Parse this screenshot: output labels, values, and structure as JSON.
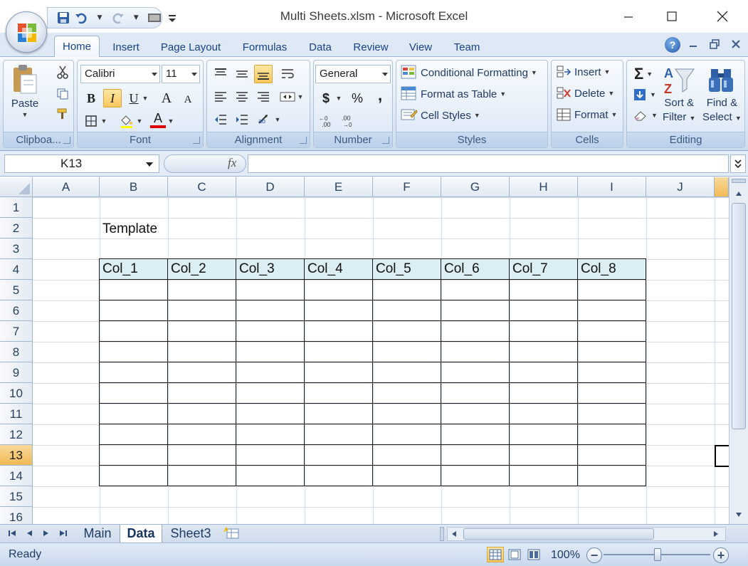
{
  "window": {
    "title": "Multi Sheets.xlsm - Microsoft Excel"
  },
  "ribbon_tabs": [
    {
      "label": "Home",
      "active": true
    },
    {
      "label": "Insert"
    },
    {
      "label": "Page Layout"
    },
    {
      "label": "Formulas"
    },
    {
      "label": "Data"
    },
    {
      "label": "Review"
    },
    {
      "label": "View"
    },
    {
      "label": "Team"
    }
  ],
  "clipboard": {
    "group_label": "Clipboa...",
    "paste_label": "Paste"
  },
  "font": {
    "group_label": "Font",
    "font_name": "Calibri",
    "font_size": "11",
    "bold": "B",
    "italic": "I",
    "underline": "U",
    "grow": "A",
    "shrink": "A",
    "font_color_letter": "A",
    "font_color": "#e00000"
  },
  "alignment": {
    "group_label": "Alignment"
  },
  "number": {
    "group_label": "Number",
    "format": "General",
    "currency": "$",
    "percent": "%",
    "comma": ","
  },
  "styles": {
    "group_label": "Styles",
    "conditional_formatting": "Conditional Formatting",
    "format_as_table": "Format as Table",
    "cell_styles": "Cell Styles"
  },
  "cells": {
    "group_label": "Cells",
    "insert": "Insert",
    "delete": "Delete",
    "format": "Format"
  },
  "editing": {
    "group_label": "Editing",
    "sort_filter_line1": "Sort &",
    "sort_filter_line2": "Filter",
    "find_select_line1": "Find &",
    "find_select_line2": "Select",
    "sigma": "Σ"
  },
  "formula_bar": {
    "name_box": "K13",
    "fx": "fx",
    "formula": ""
  },
  "grid": {
    "columns": [
      "A",
      "B",
      "C",
      "D",
      "E",
      "F",
      "G",
      "H",
      "I",
      "J"
    ],
    "rows": [
      "1",
      "2",
      "3",
      "4",
      "5",
      "6",
      "7",
      "8",
      "9",
      "10",
      "11",
      "12",
      "13",
      "14",
      "15",
      "16"
    ],
    "active_row": "13",
    "cells": {
      "B2": "Template"
    },
    "table_headers": [
      "Col_1",
      "Col_2",
      "Col_3",
      "Col_4",
      "Col_5",
      "Col_6",
      "Col_7",
      "Col_8"
    ],
    "table_header_fill": "#daeef3"
  },
  "sheet_tabs": [
    {
      "label": "Main"
    },
    {
      "label": "Data",
      "active": true
    },
    {
      "label": "Sheet3"
    }
  ],
  "status_bar": {
    "status": "Ready",
    "zoom": "100%"
  },
  "colors": {
    "ribbon_text": "#15428b",
    "selection_header": "#f1b955"
  }
}
